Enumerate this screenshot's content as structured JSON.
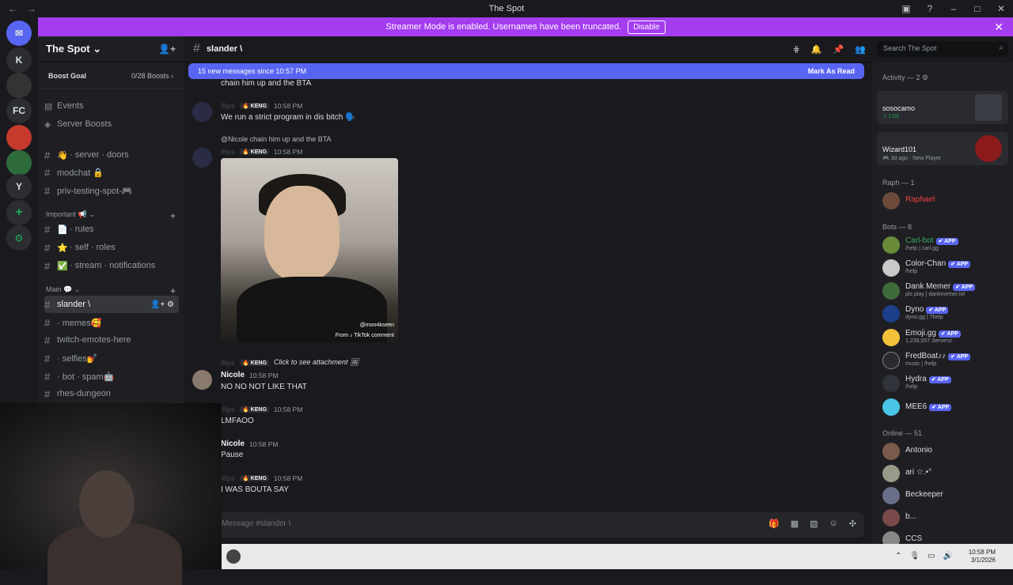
{
  "window": {
    "title": "The Spot",
    "back": "←",
    "forward": "→"
  },
  "banner": {
    "text": "Streamer Mode is enabled. Usernames have been truncated.",
    "button": "Disable",
    "close": "✕"
  },
  "rail": {
    "items": [
      "K",
      "FC",
      "Y",
      "+"
    ]
  },
  "guild": {
    "name": "The Spot ⌄",
    "boost_goal": "Boost Goal",
    "boost_count": "0/28 Boosts ›",
    "top_items": [
      "Events",
      "Server Boosts"
    ],
    "channels_a": [
      {
        "icon": "👋",
        "label": "· server · doors"
      },
      {
        "icon": "",
        "label": "modchat 🔒"
      },
      {
        "icon": "",
        "label": "priv-testing-spot-🎮"
      }
    ],
    "category_important": "Important 📢 ⌄",
    "channels_b": [
      {
        "icon": "📄",
        "label": "· rules"
      },
      {
        "icon": "⭐",
        "label": "· self · roles"
      },
      {
        "icon": "✅",
        "label": "· stream · notifications"
      }
    ],
    "category_main": "Main 💬 ⌄",
    "channels_c": [
      {
        "label": "slander \\"
      },
      {
        "label": "· memes🥰"
      },
      {
        "label": "twitch-emotes-here"
      },
      {
        "label": "· selfies💅"
      },
      {
        "label": "· bot · spam🤖"
      },
      {
        "label": "rhes-dungeon"
      }
    ]
  },
  "chat": {
    "channel": "slander \\",
    "search_placeholder": "Search The Spot",
    "new_messages": "15 new messages since 10:57 PM",
    "mark_read": "Mark As Read",
    "messages": [
      {
        "text": "chain him up and the BTA"
      },
      {
        "author": "lllps",
        "tag": "🔥 KENG",
        "time": "10:58 PM",
        "text": "We run a strict program in dis bitch 🗣️"
      },
      {
        "reply": "@Nicole chain him up and the BTA",
        "author": "lllps",
        "tag": "🔥 KENG",
        "time": "10:58 PM"
      },
      {
        "author": "lllps",
        "tag": "🔥 KENG",
        "text": "Click to see attachment 🖼"
      },
      {
        "author": "Nicole",
        "time": "10:58 PM",
        "text": "NO NO NOT LIKE THAT"
      },
      {
        "author": "lllps",
        "tag": "🔥 KENG",
        "time": "10:58 PM",
        "text": "LMFAOO"
      },
      {
        "author": "Nicole",
        "time": "10:58 PM",
        "text": "Pause"
      },
      {
        "author": "lllps",
        "tag": "🔥 KENG",
        "time": "10:58 PM",
        "text": "I WAS BOUTA SAY"
      }
    ],
    "image_caption_handle": "@mon4kseen",
    "image_caption_source": "From ♪ TikTok comment",
    "composer_placeholder": "Message #slander \\"
  },
  "members": {
    "activity_header": "Activity — 2 ⚙",
    "activity": [
      {
        "name": "sosocamo",
        "status": "♫ 1:03"
      },
      {
        "name": "Wizard101",
        "status": "🎮 3d ago · New Player"
      }
    ],
    "raph_header": "Raph — 1",
    "raph": [
      {
        "name": "Raphael"
      }
    ],
    "bots_header": "Bots — 8",
    "bots": [
      {
        "name": "Carl-bot",
        "status": "/help | carl.gg",
        "color": "#3ba55c"
      },
      {
        "name": "Color-Chan",
        "status": "/help",
        "color": "#dbdee1"
      },
      {
        "name": "Dank Memer",
        "status": "pls play | dankmemer.lol",
        "color": "#dbdee1"
      },
      {
        "name": "Dyno",
        "status": "dyno.gg | ?help",
        "color": "#dbdee1"
      },
      {
        "name": "Emoji.gg",
        "status": "1,238,057 Servers!",
        "color": "#dbdee1"
      },
      {
        "name": "FredBoat♪♪",
        "status": "music | /help",
        "color": "#dbdee1"
      },
      {
        "name": "Hydra",
        "status": "/help",
        "color": "#dbdee1"
      },
      {
        "name": "MEE6",
        "status": "",
        "color": "#dbdee1"
      }
    ],
    "app_badge": "✔ APP",
    "online_header": "Online — 51",
    "online": [
      "Antonio",
      "ari ☆.•°",
      "Beckeeper",
      "b...",
      "CCS"
    ]
  },
  "taskbar": {
    "time": "10:58 PM",
    "date": "3/1/2026"
  },
  "colors": {
    "banner": "#a43cf0",
    "accent": "#5865f2",
    "raphael": "#ed4245"
  }
}
